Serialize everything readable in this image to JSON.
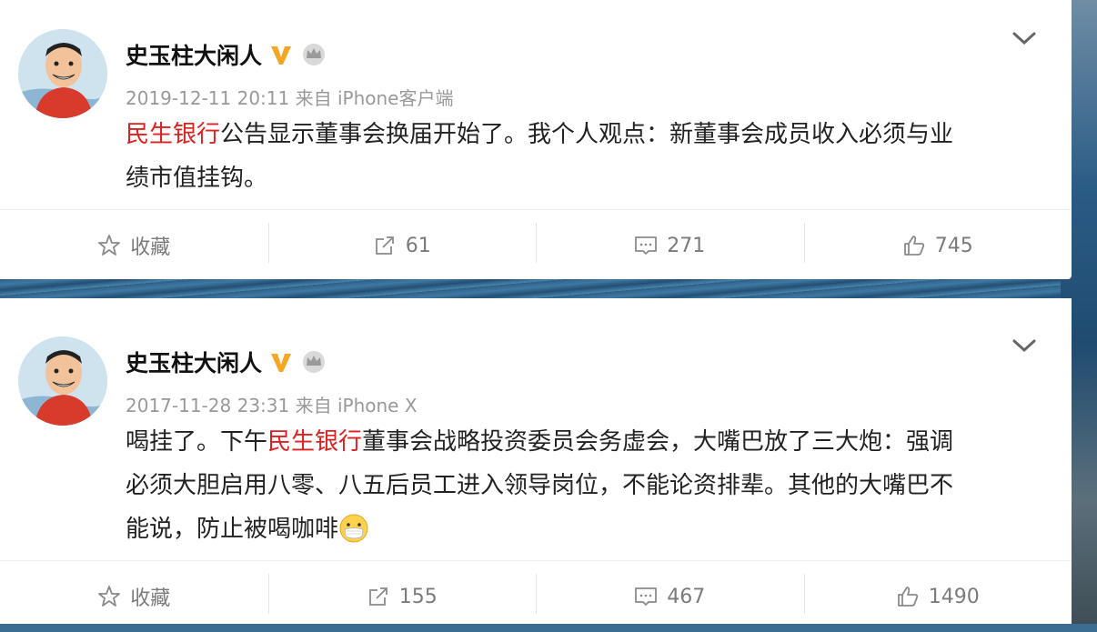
{
  "posts": [
    {
      "author": "史玉柱大闲人",
      "timestamp": "2019-12-11 20:11",
      "source": "来自 iPhone客户端",
      "text_link": "民生银行",
      "text_line1_rest": "公告显示董事会换届开始了。我个人观点：新董事会成员收入必须与业",
      "text_line2": "绩市值挂钩。",
      "actions": {
        "favorite_label": "收藏",
        "share_count": "61",
        "comment_count": "271",
        "like_count": "745"
      }
    },
    {
      "author": "史玉柱大闲人",
      "timestamp": "2017-11-28 23:31",
      "source": "来自 iPhone X",
      "text_prefix": "喝挂了。下午",
      "text_link": "民生银行",
      "text_line1_rest": "董事会战略投资委员会务虚会，大嘴巴放了三大炮：强调",
      "text_line2": "必须大胆启用八零、八五后员工进入领导岗位，不能论资排辈。其他的大嘴巴不",
      "text_line3": "能说，防止被喝咖啡",
      "emoji": "mask-face-emoji",
      "actions": {
        "favorite_label": "收藏",
        "share_count": "155",
        "comment_count": "467",
        "like_count": "1490"
      }
    }
  ],
  "colors": {
    "link": "#e02020",
    "verified_badge": "#f5a623",
    "meta_text": "#999999"
  }
}
